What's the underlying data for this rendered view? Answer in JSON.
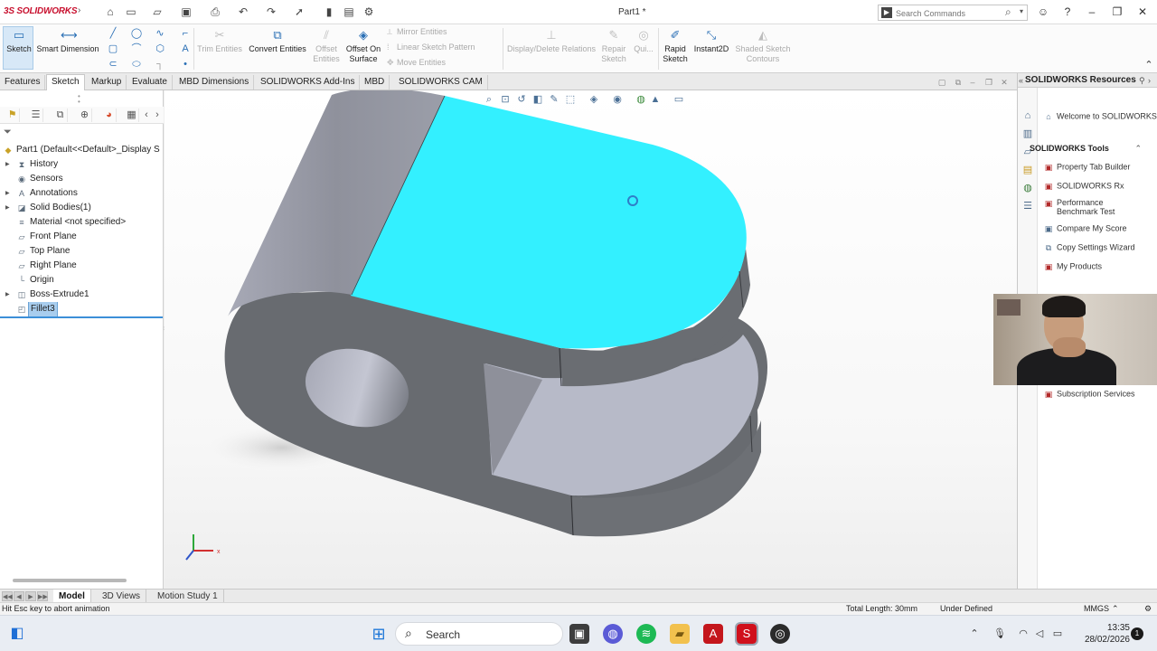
{
  "app": {
    "logo_text": "3S SOLIDWORKS",
    "document_title": "Part1 *",
    "search": {
      "placeholder": "Search Commands"
    }
  },
  "ribbon": {
    "sketch": "Sketch",
    "smart_dimension": "Smart Dimension",
    "trim_entities": "Trim Entities",
    "convert_entities": "Convert Entities",
    "offset_entities": "Offset Entities",
    "offset_on_surface": "Offset On Surface",
    "mirror_entities": "Mirror Entities",
    "linear_sketch_pattern": "Linear Sketch Pattern",
    "move_entities": "Move Entities",
    "display_delete_relations": "Display/Delete Relations",
    "repair_sketch": "Repair Sketch",
    "quick_snaps": "Qui...",
    "rapid_sketch": "Rapid Sketch",
    "instant2d": "Instant2D",
    "shaded_sketch_contours": "Shaded Sketch Contours"
  },
  "tabs": [
    "Features",
    "Sketch",
    "Markup",
    "Evaluate",
    "MBD Dimensions",
    "SOLIDWORKS Add-Ins",
    "MBD",
    "SOLIDWORKS CAM"
  ],
  "active_tab": "Sketch",
  "tree": {
    "root": "Part1  (Default<<Default>_Display S",
    "items": [
      {
        "label": "History",
        "expandable": true,
        "icon": "history-icon"
      },
      {
        "label": "Sensors",
        "expandable": false,
        "icon": "sensor-icon"
      },
      {
        "label": "Annotations",
        "expandable": true,
        "icon": "annotation-icon"
      },
      {
        "label": "Solid Bodies(1)",
        "expandable": true,
        "icon": "solid-body-icon"
      },
      {
        "label": "Material <not specified>",
        "expandable": false,
        "icon": "material-icon"
      },
      {
        "label": "Front Plane",
        "expandable": false,
        "icon": "plane-icon"
      },
      {
        "label": "Top Plane",
        "expandable": false,
        "icon": "plane-icon"
      },
      {
        "label": "Right Plane",
        "expandable": false,
        "icon": "plane-icon"
      },
      {
        "label": "Origin",
        "expandable": false,
        "icon": "origin-icon"
      },
      {
        "label": "Boss-Extrude1",
        "expandable": true,
        "icon": "extrude-icon"
      },
      {
        "label": "Fillet3",
        "expandable": false,
        "icon": "fillet-icon",
        "selected": true
      }
    ]
  },
  "taskpane": {
    "title": "SOLIDWORKS Resources",
    "welcome": "Welcome to SOLIDWORKS",
    "tools_title": "SOLIDWORKS Tools",
    "tools": [
      "Property Tab Builder",
      "SOLIDWORKS Rx",
      "Performance Benchmark Test",
      "Compare My Score",
      "Copy Settings Wizard",
      "My Products"
    ],
    "subscription": "Subscription Services"
  },
  "bottom_tabs": [
    "Model",
    "3D Views",
    "Motion Study 1"
  ],
  "active_bottom_tab": "Model",
  "status": {
    "hint": "Hit Esc key to abort animation",
    "total_length": "Total Length: 30mm",
    "state": "Under Defined",
    "units": "MMGS"
  },
  "taskbar": {
    "search_label": "Search",
    "time": "13:35",
    "date": "28/02/2026",
    "notifications": "1"
  },
  "colors": {
    "selected_face": "#33f0ff",
    "body_dark": "#6a6d72",
    "body_light": "#b7bac8",
    "accent": "#2a6fb5",
    "brand": "#c8102e"
  }
}
